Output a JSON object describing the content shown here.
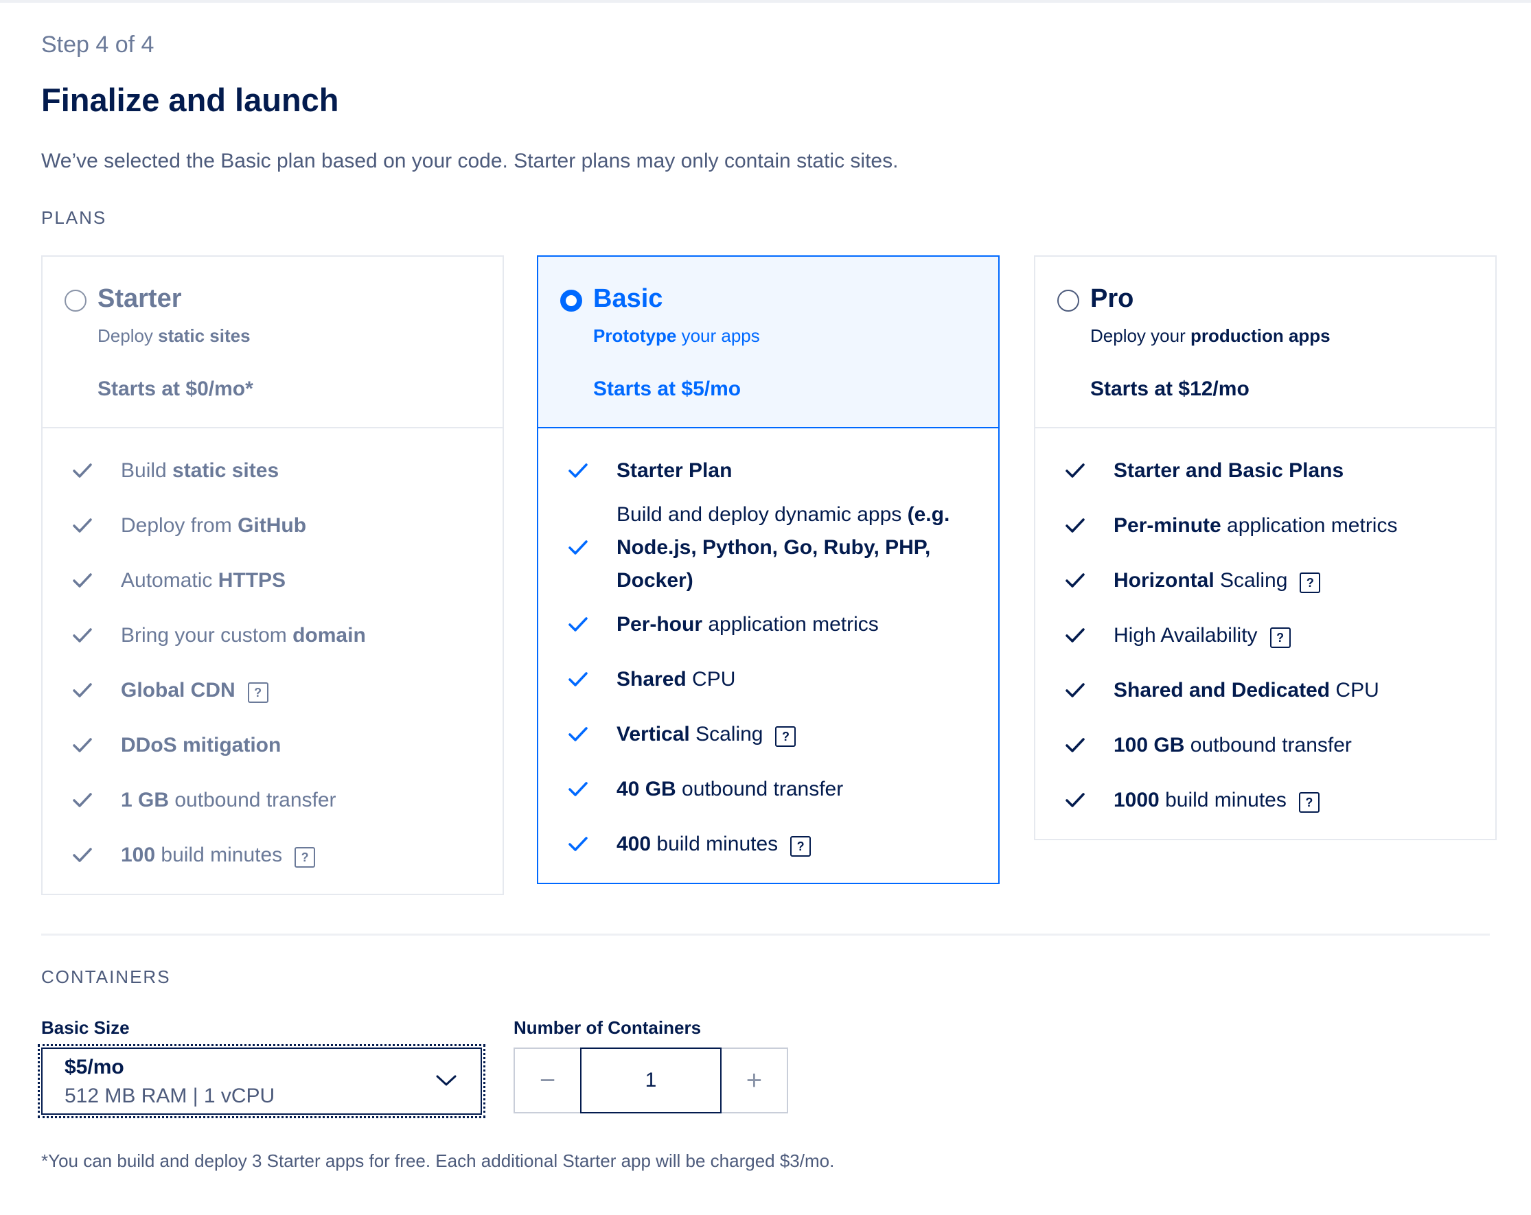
{
  "header": {
    "step": "Step 4 of 4",
    "title": "Finalize and launch",
    "description": "We’ve selected the Basic plan based on your code. Starter plans may only contain static sites."
  },
  "plans_label": "PLANS",
  "plans": [
    {
      "name": "Starter",
      "subtitle": [
        {
          "t": "Deploy "
        },
        {
          "t": "static sites",
          "b": true
        }
      ],
      "price": "Starts at $0/mo*",
      "selected": false,
      "features": [
        {
          "parts": [
            {
              "t": "Build "
            },
            {
              "t": "static sites",
              "b": true
            }
          ]
        },
        {
          "parts": [
            {
              "t": "Deploy from "
            },
            {
              "t": "GitHub",
              "b": true
            }
          ]
        },
        {
          "parts": [
            {
              "t": "Automatic "
            },
            {
              "t": "HTTPS",
              "b": true
            }
          ]
        },
        {
          "parts": [
            {
              "t": "Bring your custom "
            },
            {
              "t": "domain",
              "b": true
            }
          ]
        },
        {
          "parts": [
            {
              "t": "Global CDN",
              "b": true
            }
          ],
          "help": true
        },
        {
          "parts": [
            {
              "t": "DDoS mitigation",
              "b": true
            }
          ]
        },
        {
          "parts": [
            {
              "t": "1 GB",
              "b": true
            },
            {
              "t": " outbound transfer"
            }
          ]
        },
        {
          "parts": [
            {
              "t": "100",
              "b": true
            },
            {
              "t": " build minutes"
            }
          ],
          "help": true
        }
      ]
    },
    {
      "name": "Basic",
      "subtitle": [
        {
          "t": "Prototype",
          "b": true
        },
        {
          "t": " your apps"
        }
      ],
      "price": "Starts at $5/mo",
      "selected": true,
      "features": [
        {
          "parts": [
            {
              "t": "Starter Plan",
              "b": true
            }
          ]
        },
        {
          "parts": [
            {
              "t": "Build and deploy dynamic apps "
            },
            {
              "t": "(e.g. Node.js, Python, Go, Ruby, PHP, Docker)",
              "b": true
            }
          ]
        },
        {
          "parts": [
            {
              "t": "Per-hour",
              "b": true
            },
            {
              "t": " application metrics"
            }
          ]
        },
        {
          "parts": [
            {
              "t": "Shared",
              "b": true
            },
            {
              "t": " CPU"
            }
          ]
        },
        {
          "parts": [
            {
              "t": "Vertical",
              "b": true
            },
            {
              "t": " Scaling"
            }
          ],
          "help": true
        },
        {
          "parts": [
            {
              "t": "40 GB",
              "b": true
            },
            {
              "t": " outbound transfer"
            }
          ]
        },
        {
          "parts": [
            {
              "t": "400",
              "b": true
            },
            {
              "t": " build minutes"
            }
          ],
          "help": true
        }
      ]
    },
    {
      "name": "Pro",
      "subtitle": [
        {
          "t": "Deploy your "
        },
        {
          "t": "production apps",
          "b": true
        }
      ],
      "price": "Starts at $12/mo",
      "selected": false,
      "features": [
        {
          "parts": [
            {
              "t": "Starter and Basic Plans",
              "b": true
            }
          ]
        },
        {
          "parts": [
            {
              "t": "Per-minute",
              "b": true
            },
            {
              "t": " application metrics"
            }
          ]
        },
        {
          "parts": [
            {
              "t": "Horizontal",
              "b": true
            },
            {
              "t": " Scaling"
            }
          ],
          "help": true
        },
        {
          "parts": [
            {
              "t": "High Availability"
            }
          ],
          "help": true
        },
        {
          "parts": [
            {
              "t": "Shared and Dedicated",
              "b": true
            },
            {
              "t": " CPU"
            }
          ]
        },
        {
          "parts": [
            {
              "t": "100 GB",
              "b": true
            },
            {
              "t": " outbound transfer"
            }
          ]
        },
        {
          "parts": [
            {
              "t": "1000",
              "b": true
            },
            {
              "t": " build minutes"
            }
          ],
          "help": true
        }
      ]
    }
  ],
  "containers": {
    "label": "CONTAINERS",
    "size_label": "Basic Size",
    "size_price": "$5/mo",
    "size_spec": "512 MB RAM | 1 vCPU",
    "count_label": "Number of Containers",
    "count_value": "1",
    "minus": "−",
    "plus": "+"
  },
  "help_glyph": "?",
  "footnote": "*You can build and deploy 3 Starter apps for free. Each additional Starter app will be charged $3/mo.",
  "colors": {
    "accent": "#0069ff",
    "text": "#031b4e",
    "muted": "#6b7a99",
    "selected_bg": "#f1f7ff"
  }
}
